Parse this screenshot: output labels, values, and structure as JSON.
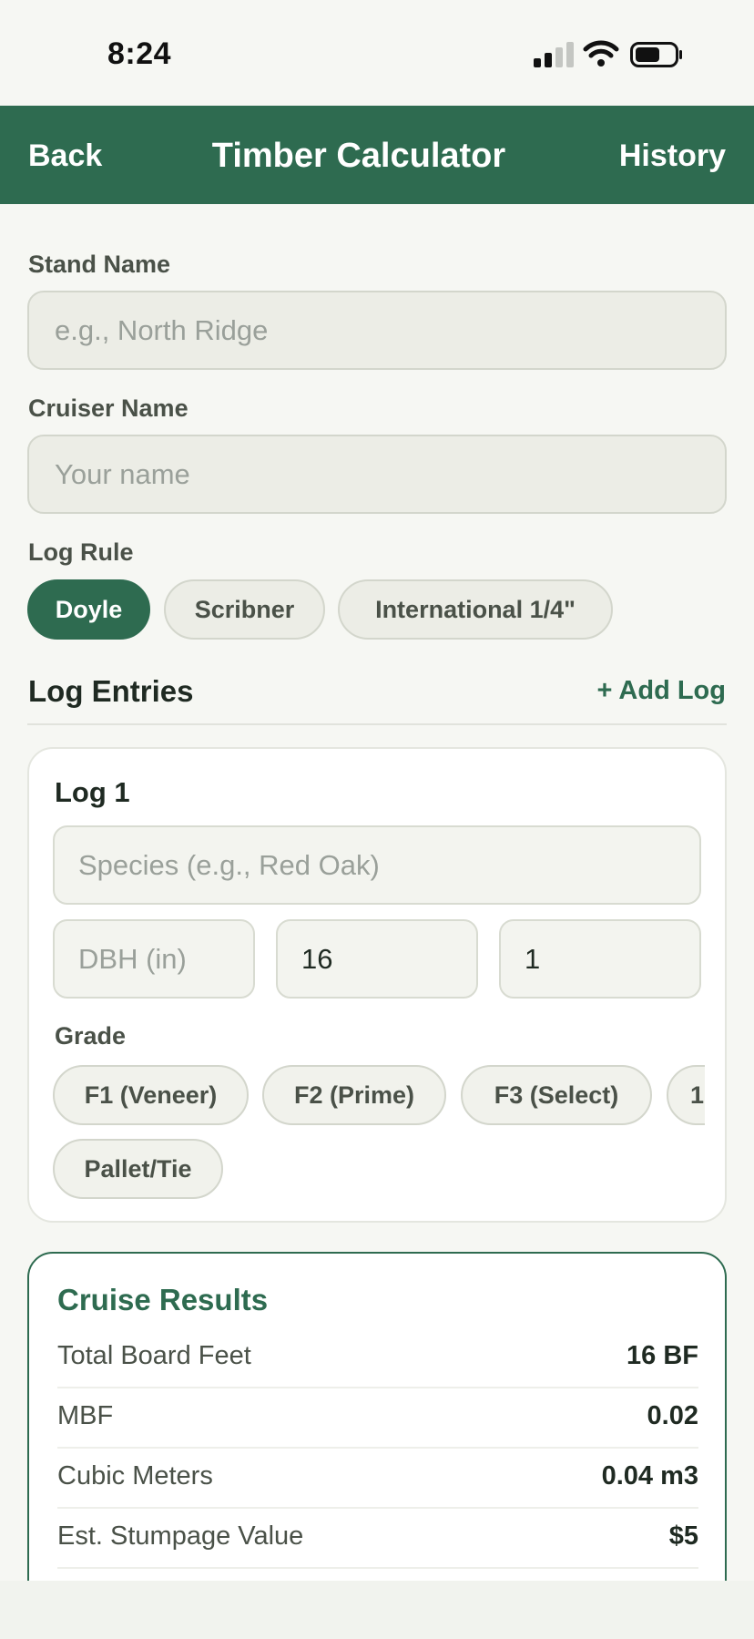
{
  "status_bar": {
    "time": "8:24"
  },
  "nav": {
    "back_label": "Back",
    "title": "Timber Calculator",
    "history_label": "History"
  },
  "form": {
    "stand_name": {
      "label": "Stand Name",
      "placeholder": "e.g., North Ridge",
      "value": ""
    },
    "cruiser_name": {
      "label": "Cruiser Name",
      "placeholder": "Your name",
      "value": ""
    },
    "log_rule": {
      "label": "Log Rule",
      "options": [
        "Doyle",
        "Scribner",
        "International 1/4\""
      ],
      "selected": "Doyle"
    }
  },
  "log_entries": {
    "title": "Log Entries",
    "add_label": "+ Add Log",
    "logs": [
      {
        "title": "Log 1",
        "species_placeholder": "Species (e.g., Red Oak)",
        "dbh_placeholder": "DBH (in)",
        "length_value": "16",
        "count_value": "1",
        "grade_label": "Grade",
        "grades": [
          "F1 (Veneer)",
          "F2 (Prime)",
          "F3 (Select)",
          "1",
          "Pallet/Tie"
        ]
      }
    ]
  },
  "results": {
    "title": "Cruise Results",
    "rows": [
      {
        "label": "Total Board Feet",
        "value": "16 BF"
      },
      {
        "label": "MBF",
        "value": "0.02"
      },
      {
        "label": "Cubic Meters",
        "value": "0.04 m3"
      },
      {
        "label": "Est. Stumpage Value",
        "value": "$5"
      }
    ]
  },
  "colors": {
    "primary": "#2e6b50",
    "background": "#f6f7f3",
    "field": "#ecede6"
  }
}
